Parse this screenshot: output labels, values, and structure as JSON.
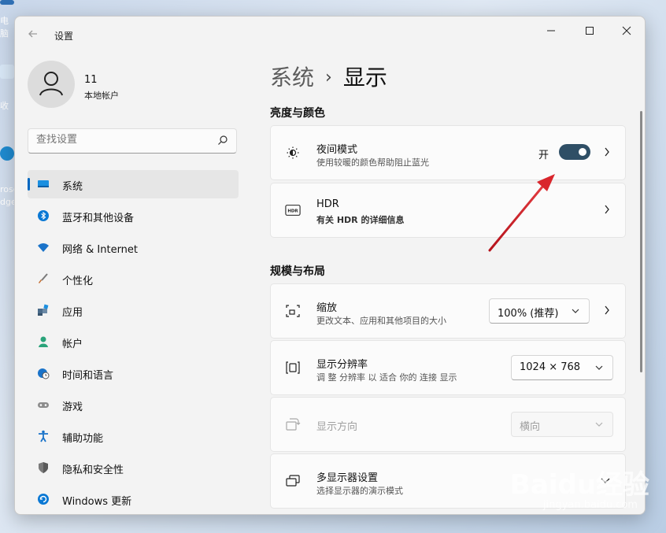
{
  "desktop": {
    "icon1_label": "电脑",
    "icon2_label": "收",
    "icon3_label": "rosc",
    "icon4_label": "dge"
  },
  "window": {
    "app_title": "设置",
    "back_icon": "back-arrow-icon",
    "minimize_label": "—",
    "maximize_label": "☐",
    "close_label": "✕"
  },
  "profile": {
    "name": "11",
    "account_type": "本地帐户"
  },
  "search": {
    "placeholder": "查找设置"
  },
  "sidebar": {
    "items": [
      {
        "label": "系统",
        "icon": "monitor-icon",
        "color": "#0067c0",
        "active": true
      },
      {
        "label": "蓝牙和其他设备",
        "icon": "bluetooth-icon",
        "color": "#0078d4"
      },
      {
        "label": "网络 & Internet",
        "icon": "wifi-icon",
        "color": "#1a73c9"
      },
      {
        "label": "个性化",
        "icon": "brush-icon",
        "color": "#c46a2b"
      },
      {
        "label": "应用",
        "icon": "apps-icon",
        "color": "#4a6b8a"
      },
      {
        "label": "帐户",
        "icon": "person-icon",
        "color": "#2aa37a"
      },
      {
        "label": "时间和语言",
        "icon": "globe-clock-icon",
        "color": "#1a73c9"
      },
      {
        "label": "游戏",
        "icon": "gamepad-icon",
        "color": "#666666"
      },
      {
        "label": "辅助功能",
        "icon": "accessibility-icon",
        "color": "#1a73c9"
      },
      {
        "label": "隐私和安全性",
        "icon": "shield-icon",
        "color": "#6b6b6b"
      },
      {
        "label": "Windows 更新",
        "icon": "update-icon",
        "color": "#0078d4"
      }
    ]
  },
  "main": {
    "breadcrumb_parent": "系统",
    "breadcrumb_sep": "›",
    "breadcrumb_current": "显示",
    "section_brightness": "亮度与颜色",
    "night_mode": {
      "title": "夜间模式",
      "desc": "使用较暖的颜色帮助阻止蓝光",
      "toggle_label": "开",
      "toggle_on": true
    },
    "hdr": {
      "title": "HDR",
      "desc": "有关 HDR 的详细信息",
      "badge": "HDR"
    },
    "section_layout": "规模与布局",
    "scale": {
      "title": "缩放",
      "desc": "更改文本、应用和其他项目的大小",
      "value": "100% (推荐)"
    },
    "resolution": {
      "title": "显示分辨率",
      "desc": "调 整 分辨率 以 适合 你的 连接 显示",
      "value": "1024 × 768"
    },
    "orientation": {
      "title": "显示方向",
      "value": "横向"
    },
    "multi_display": {
      "title": "多显示器设置",
      "desc": "选择显示器的演示模式"
    }
  },
  "colors": {
    "accent": "#0067c0",
    "toggle_on": "#2f4f66",
    "annotation_arrow": "#d9262c"
  },
  "watermark": {
    "text": "Baidu经验",
    "sub": "jingyan.baidu.com"
  }
}
